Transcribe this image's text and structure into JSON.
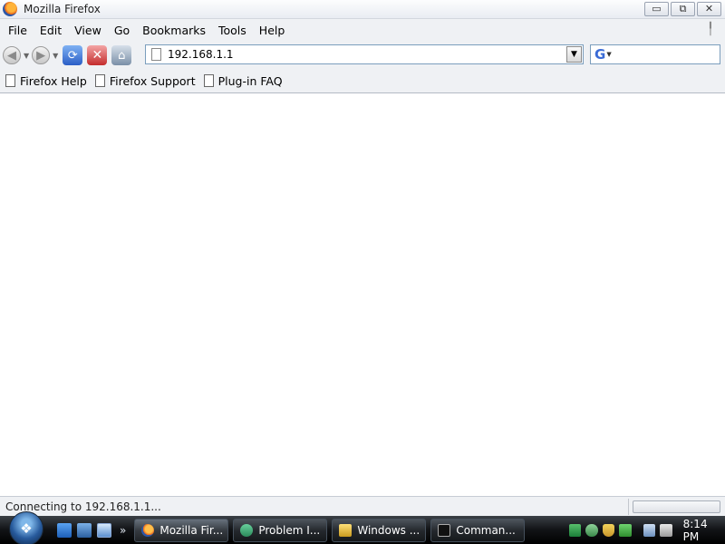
{
  "window": {
    "title": "Mozilla Firefox",
    "controls": {
      "minimize": "▭",
      "maximize": "⧉",
      "close": "✕"
    }
  },
  "menu": {
    "items": [
      "File",
      "Edit",
      "View",
      "Go",
      "Bookmarks",
      "Tools",
      "Help"
    ]
  },
  "navigation": {
    "back_icon": "back-arrow-icon",
    "forward_icon": "forward-arrow-icon",
    "reload_icon": "reload-icon",
    "stop_icon": "stop-icon",
    "home_icon": "home-icon",
    "url": "192.168.1.1",
    "search_engine_icon": "G",
    "search_placeholder": ""
  },
  "bookmarks": {
    "items": [
      "Firefox Help",
      "Firefox Support",
      "Plug-in FAQ"
    ]
  },
  "status": {
    "text": "Connecting to 192.168.1.1..."
  },
  "taskbar": {
    "start_icon": "windows-start-orb",
    "quick_launch": [
      "show-desktop-icon",
      "switch-windows-icon",
      "internet-explorer-icon"
    ],
    "overflow": "»",
    "buttons": [
      {
        "label": "Mozilla Fir...",
        "icon": "firefox-icon",
        "active": true
      },
      {
        "label": "Problem I...",
        "icon": "problem-reports-icon",
        "active": false
      },
      {
        "label": "Windows ...",
        "icon": "windows-explorer-icon",
        "active": false
      },
      {
        "label": "Comman...",
        "icon": "command-prompt-icon",
        "active": false
      }
    ],
    "tray_icons": [
      "network-status-icon",
      "users-icon",
      "security-shield-icon",
      "checkmark-icon",
      "network-icon",
      "volume-muted-icon"
    ],
    "clock": "8:14 PM"
  },
  "colors": {
    "chrome": "#eff1f4",
    "taskbar": "#121417",
    "url_border": "#7b9ebd"
  }
}
